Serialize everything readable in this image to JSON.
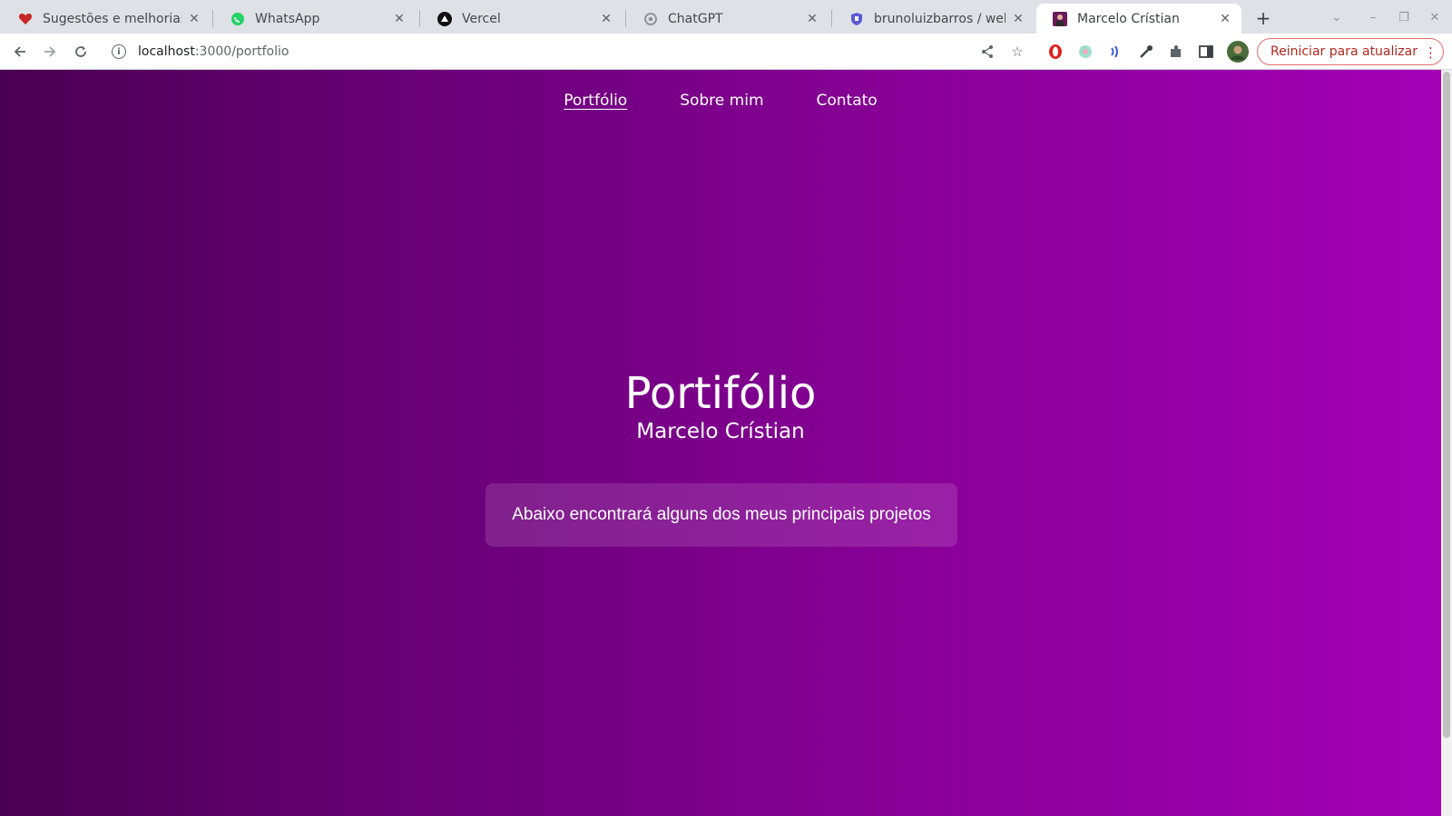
{
  "browser": {
    "tabs": [
      {
        "title": "Sugestões e melhorias",
        "favicon": "heart-icon"
      },
      {
        "title": "WhatsApp",
        "favicon": "whatsapp-icon"
      },
      {
        "title": "Vercel",
        "favicon": "vercel-icon"
      },
      {
        "title": "ChatGPT",
        "favicon": "chatgpt-icon"
      },
      {
        "title": "brunoluizbarros / web",
        "favicon": "shield-icon"
      },
      {
        "title": "Marcelo Crístian",
        "favicon": "site-avatar-icon"
      }
    ],
    "active_tab_index": 5,
    "url_host": "localhost",
    "url_path": ":3000/portfolio",
    "update_button_label": "Reiniciar para atualizar"
  },
  "site": {
    "nav": [
      "Portfólio",
      "Sobre mim",
      "Contato"
    ],
    "current_nav_index": 0,
    "heading": "Portifólio",
    "subheading": "Marcelo Crístian",
    "intro": "Abaixo encontrará alguns dos meus principais projetos"
  },
  "colors": {
    "gradient_start": "#4a0052",
    "gradient_end": "#a300b5",
    "update_accent": "#b3261e"
  }
}
